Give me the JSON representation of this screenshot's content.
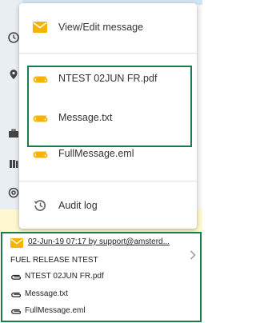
{
  "colors": {
    "accent_amber": "#f4b400",
    "frame_green": "#1d7a4a",
    "icon_grey": "#666666"
  },
  "menu": {
    "view_edit": {
      "label": "View/Edit message",
      "icon": "envelope-icon"
    },
    "attachments": [
      {
        "label": "NTEST 02JUN FR.pdf",
        "icon": "paperclip-icon"
      },
      {
        "label": "Message.txt",
        "icon": "paperclip-icon"
      },
      {
        "label": "FullMessage.eml",
        "icon": "paperclip-icon"
      }
    ],
    "audit_log": {
      "label": "Audit log",
      "icon": "history-icon"
    }
  },
  "message": {
    "header": "02-Jun-19 07:17 by support@amsterd...",
    "subject": "FUEL RELEASE NTEST",
    "attachments": [
      "NTEST 02JUN FR.pdf",
      "Message.txt",
      "FullMessage.eml"
    ]
  }
}
